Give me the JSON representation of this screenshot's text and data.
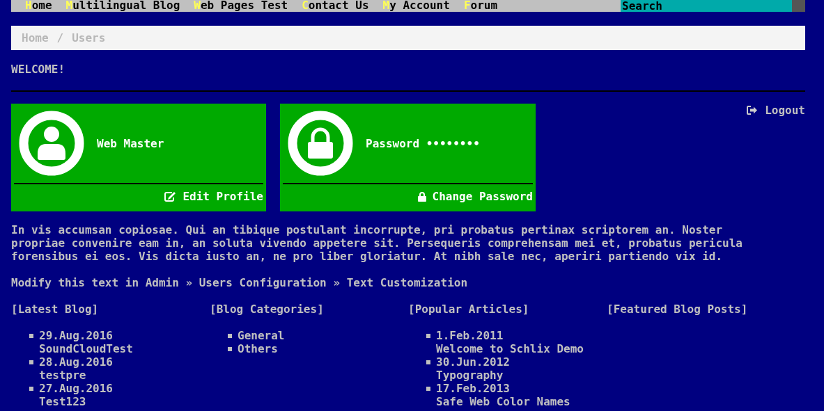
{
  "menu": [
    {
      "label": "Home"
    },
    {
      "label": "Multilingual Blog"
    },
    {
      "label": "Web Pages Test"
    },
    {
      "label": "Contact Us"
    },
    {
      "label": "My Account"
    },
    {
      "label": "Forum"
    }
  ],
  "search": {
    "placeholder": "Search"
  },
  "breadcrumb": {
    "separator": "/",
    "items": [
      "Home",
      "Users"
    ]
  },
  "welcome": "WELCOME!",
  "logout": "Logout",
  "cards": [
    {
      "kind": "user",
      "title": "Web Master",
      "action": "Edit Profile"
    },
    {
      "kind": "password",
      "title": "Password ••••••••",
      "action": "Change Password"
    }
  ],
  "intro": "In vis accumsan copiosae. Qui an tibique postulant incorrupte, pri probatus pertinax scriptorem an. Noster propriae convenire eam in, an soluta vivendo appetere sit. Persequeris comprehensam mei et, probatus pericula forensibus ei eos. Vis dicta iusto an, ne pro liber gloriatur. At nibh sale nec, aperiri partiendo vix id.",
  "note": "Modify this text in Admin » Users Configuration » Text Customization",
  "columns": [
    {
      "heading": "[Latest Blog]",
      "items": [
        {
          "date": "29.Aug.2016",
          "title": "SoundCloudTest"
        },
        {
          "date": "28.Aug.2016",
          "title": "testpre"
        },
        {
          "date": "27.Aug.2016",
          "title": "Test123"
        }
      ]
    },
    {
      "heading": "[Blog Categories]",
      "items": [
        {
          "title": "General"
        },
        {
          "title": "Others"
        }
      ]
    },
    {
      "heading": "[Popular Articles]",
      "items": [
        {
          "date": "1.Feb.2011",
          "title": "Welcome to Schlix Demo"
        },
        {
          "date": "30.Jun.2012",
          "title": "Typography"
        },
        {
          "date": "17.Feb.2013",
          "title": "Safe Web Color Names"
        }
      ]
    },
    {
      "heading": "[Featured Blog Posts]"
    }
  ]
}
